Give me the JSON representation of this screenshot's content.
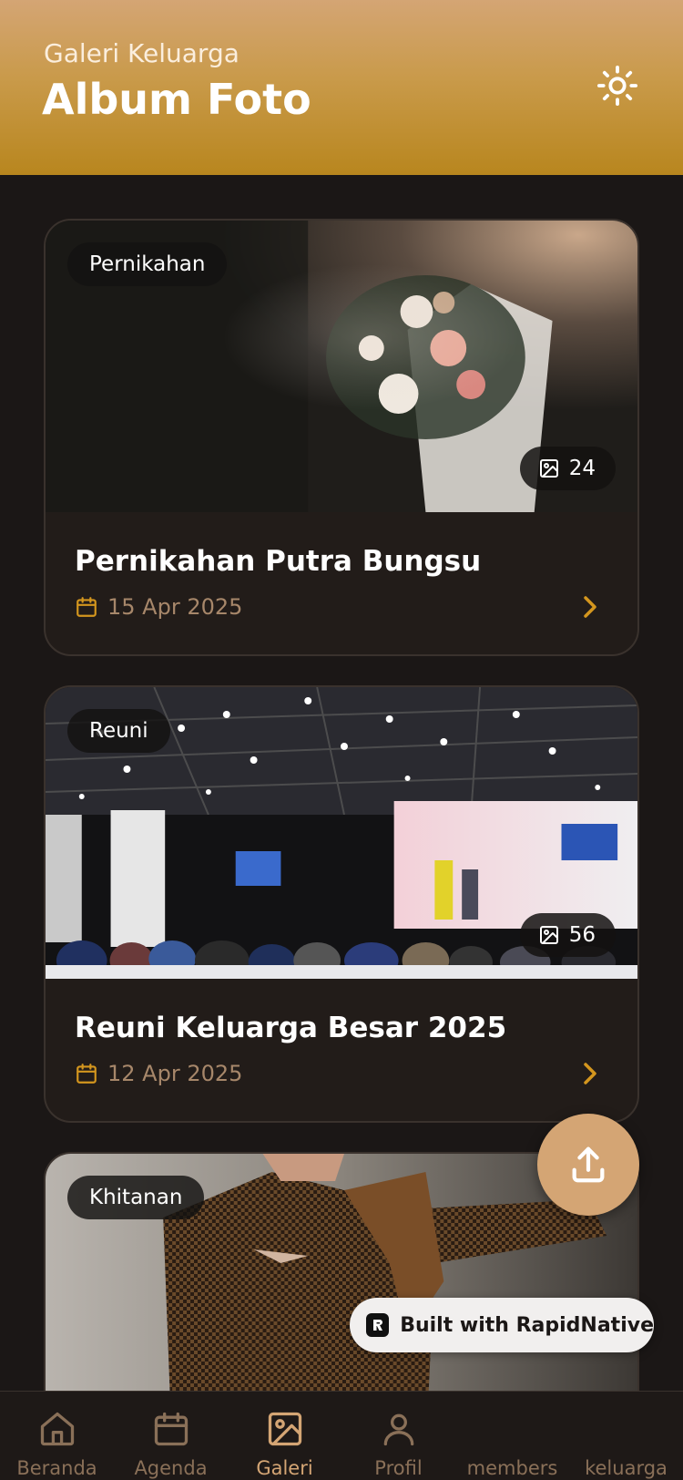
{
  "header": {
    "subtitle": "Galeri Keluarga",
    "title": "Album Foto",
    "theme_icon": "sun-icon"
  },
  "albums": [
    {
      "tag": "Pernikahan",
      "count": "24",
      "title": "Pernikahan Putra Bungsu",
      "date": "15 Apr 2025"
    },
    {
      "tag": "Reuni",
      "count": "56",
      "title": "Reuni Keluarga Besar 2025",
      "date": "12 Apr 2025"
    },
    {
      "tag": "Khitanan"
    }
  ],
  "fab": {
    "icon": "upload-icon"
  },
  "badge": {
    "label": "Built with RapidNative"
  },
  "tabs": [
    {
      "label": "Beranda",
      "icon": "home-icon"
    },
    {
      "label": "Agenda",
      "icon": "calendar-icon"
    },
    {
      "label": "Galeri",
      "icon": "image-icon",
      "active": true
    },
    {
      "label": "Profil",
      "icon": "user-icon"
    },
    {
      "label": "members"
    },
    {
      "label": "keluarga"
    }
  ],
  "colors": {
    "accent": "#d4a574",
    "header_top": "#d4a574",
    "header_bottom": "#b8861e",
    "background": "#1b1716",
    "card": "#221c19",
    "date_text": "#a7876a",
    "chevron": "#d4961e"
  }
}
